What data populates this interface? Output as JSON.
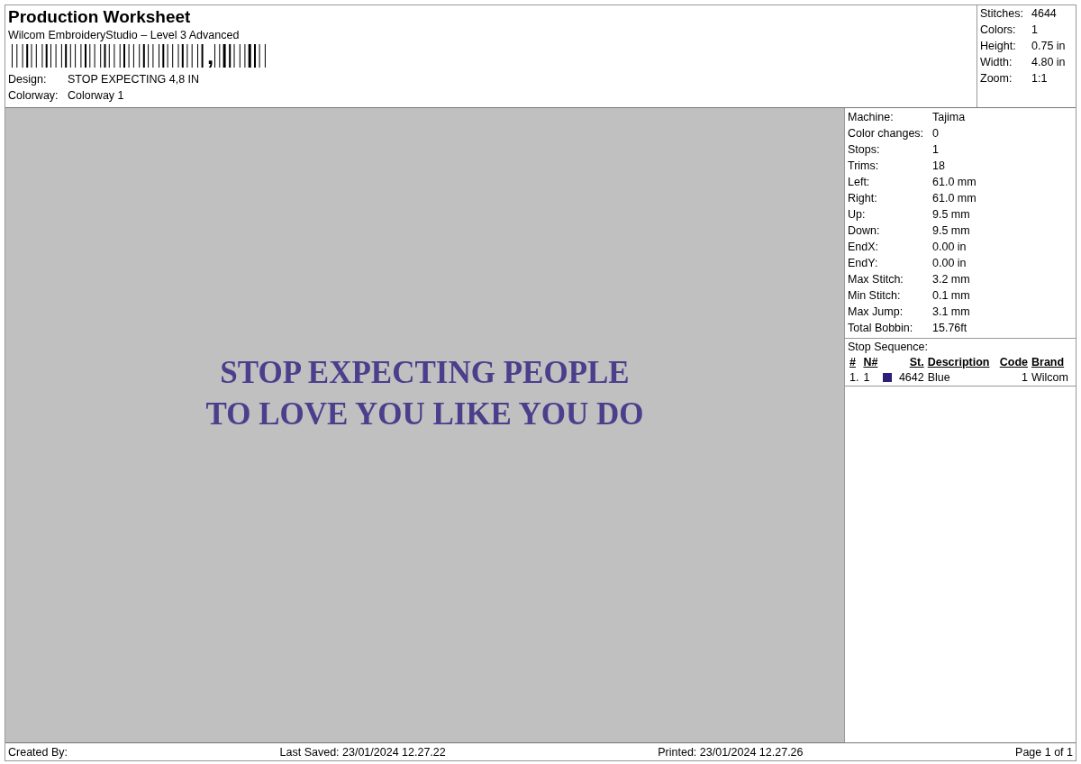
{
  "header": {
    "title": "Production Worksheet",
    "subtitle": "Wilcom EmbroideryStudio – Level 3 Advanced",
    "barcode": {
      "separator": ","
    },
    "fields": [
      {
        "label": "Design:",
        "value": "STOP EXPECTING 4,8 IN"
      },
      {
        "label": "Colorway:",
        "value": "Colorway 1"
      }
    ]
  },
  "summary": [
    {
      "label": "Stitches:",
      "value": "4644"
    },
    {
      "label": "Colors:",
      "value": "1"
    },
    {
      "label": "Height:",
      "value": "0.75 in"
    },
    {
      "label": "Width:",
      "value": "4.80 in"
    },
    {
      "label": "Zoom:",
      "value": "1:1"
    }
  ],
  "design_preview": {
    "lines": [
      "STOP EXPECTING PEOPLE",
      "TO LOVE YOU LIKE YOU DO"
    ]
  },
  "details": [
    {
      "label": "Machine:",
      "value": "Tajima"
    },
    {
      "label": "Color changes:",
      "value": "0"
    },
    {
      "label": "Stops:",
      "value": "1"
    },
    {
      "label": "Trims:",
      "value": "18"
    },
    {
      "label": "Left:",
      "value": "61.0 mm"
    },
    {
      "label": "Right:",
      "value": "61.0 mm"
    },
    {
      "label": "Up:",
      "value": "9.5 mm"
    },
    {
      "label": "Down:",
      "value": "9.5 mm"
    },
    {
      "label": "EndX:",
      "value": "0.00 in"
    },
    {
      "label": "EndY:",
      "value": "0.00 in"
    },
    {
      "label": "Max Stitch:",
      "value": "3.2 mm"
    },
    {
      "label": "Min Stitch:",
      "value": "0.1 mm"
    },
    {
      "label": "Max Jump:",
      "value": "3.1 mm"
    },
    {
      "label": "Total Bobbin:",
      "value": "15.76ft"
    }
  ],
  "stop_sequence": {
    "title": "Stop Sequence:",
    "columns": [
      "#",
      "N#",
      "St.",
      "Description",
      "Code",
      "Brand"
    ],
    "rows": [
      {
        "index": "1.",
        "needle": "1",
        "color": "#2b1f7a",
        "stitches": "4642",
        "description": "Blue",
        "code": "1",
        "brand": "Wilcom"
      }
    ]
  },
  "footer": {
    "created_by": "Created By:",
    "last_saved": "Last Saved: 23/01/2024 12.27.22",
    "printed": "Printed: 23/01/2024 12.27.26",
    "page": "Page 1 of 1"
  }
}
